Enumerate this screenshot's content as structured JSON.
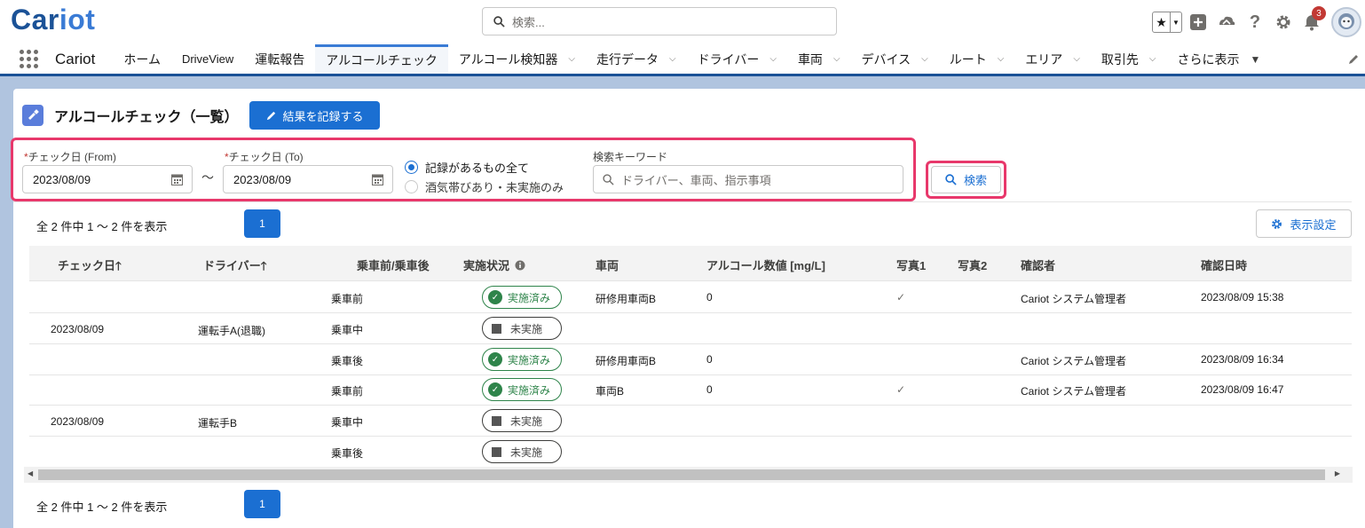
{
  "header": {
    "logo": "Cariot",
    "logo_prefix": "Car",
    "logo_suffix": "iot",
    "search_placeholder": "検索...",
    "notification_count": "3"
  },
  "nav": {
    "app_name": "Cariot",
    "items": [
      {
        "label": "ホーム",
        "dropdown": false
      },
      {
        "label": "DriveView",
        "dropdown": false
      },
      {
        "label": "運転報告",
        "dropdown": false
      },
      {
        "label": "アルコールチェック",
        "dropdown": false,
        "active": true
      },
      {
        "label": "アルコール検知器",
        "dropdown": true
      },
      {
        "label": "走行データ",
        "dropdown": true
      },
      {
        "label": "ドライバー",
        "dropdown": true
      },
      {
        "label": "車両",
        "dropdown": true
      },
      {
        "label": "デバイス",
        "dropdown": true
      },
      {
        "label": "ルート",
        "dropdown": true
      },
      {
        "label": "エリア",
        "dropdown": true
      },
      {
        "label": "取引先",
        "dropdown": true
      },
      {
        "label": "さらに表示",
        "dropdown": true
      }
    ]
  },
  "page": {
    "title": "アルコールチェック（一覧）",
    "record_button": "結果を記録する"
  },
  "filters": {
    "required_mark": "*",
    "from_label": "チェック日 (From)",
    "from_value": "2023/08/09",
    "to_label": "チェック日 (To)",
    "to_value": "2023/08/09",
    "tilde": "〜",
    "radio_all": "記録があるもの全て",
    "radio_alert": "酒気帯びあり・未実施のみ",
    "keyword_label": "検索キーワード",
    "keyword_placeholder": "ドライバー、車両、指示事項",
    "search_button": "検索"
  },
  "pagination": {
    "count_text": "全 2 件中 1 〜 2 件を表示",
    "page": "1",
    "settings_button": "表示設定"
  },
  "table": {
    "headers": [
      "チェック日",
      "ドライバー",
      "乗車前/乗車後",
      "実施状況",
      "車両",
      "アルコール数値 [mg/L]",
      "写真1",
      "写真2",
      "確認者",
      "確認日時"
    ],
    "sort_arrow": "🡑",
    "groups": [
      {
        "date": "2023/08/09",
        "driver": "運転手A(退職)",
        "rows": [
          {
            "timing": "乗車前",
            "status": "実施済み",
            "done": true,
            "vehicle": "研修用車両B",
            "alcohol": "0",
            "photo1": "✓",
            "photo2": "",
            "confirmer": "Cariot システム管理者",
            "confirmed_at": "2023/08/09 15:38"
          },
          {
            "timing": "乗車中",
            "status": "未実施",
            "done": false,
            "vehicle": "",
            "alcohol": "",
            "photo1": "",
            "photo2": "",
            "confirmer": "",
            "confirmed_at": ""
          },
          {
            "timing": "乗車後",
            "status": "実施済み",
            "done": true,
            "vehicle": "研修用車両B",
            "alcohol": "0",
            "photo1": "",
            "photo2": "",
            "confirmer": "Cariot システム管理者",
            "confirmed_at": "2023/08/09 16:34"
          }
        ]
      },
      {
        "date": "2023/08/09",
        "driver": "運転手B",
        "rows": [
          {
            "timing": "乗車前",
            "status": "実施済み",
            "done": true,
            "vehicle": "車両B",
            "alcohol": "0",
            "photo1": "✓",
            "photo2": "",
            "confirmer": "Cariot システム管理者",
            "confirmed_at": "2023/08/09 16:47"
          },
          {
            "timing": "乗車中",
            "status": "未実施",
            "done": false,
            "vehicle": "",
            "alcohol": "",
            "photo1": "",
            "photo2": "",
            "confirmer": "",
            "confirmed_at": ""
          },
          {
            "timing": "乗車後",
            "status": "未実施",
            "done": false,
            "vehicle": "",
            "alcohol": "",
            "photo1": "",
            "photo2": "",
            "confirmer": "",
            "confirmed_at": ""
          }
        ]
      }
    ]
  },
  "colors": {
    "brand": "#1b5297",
    "primary": "#1b6fd2",
    "highlight": "#e8386b",
    "done": "#2e844a"
  }
}
